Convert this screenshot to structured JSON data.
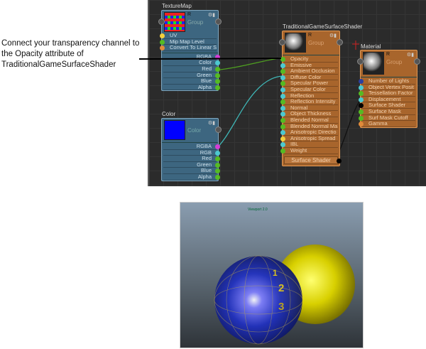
{
  "callout": {
    "text": "Connect your transparency channel to the Opacity attribute of TraditionalGameSurfaceShader"
  },
  "nodes": {
    "texturemap": {
      "title": "TextureMap",
      "header_r": "R",
      "header_group": "Group",
      "inputs": [
        {
          "label": "UV",
          "color": "#f2cf3c"
        },
        {
          "label": "Mip Map Level",
          "color": "#55bb22"
        },
        {
          "label": "Convert To Linear S",
          "color": "#e08a3a"
        }
      ],
      "outputs": [
        {
          "label": "RGBA",
          "color": "#d63cd6"
        },
        {
          "label": "Color",
          "color": "#4cc9d0"
        },
        {
          "label": "Red",
          "color": "#55bb22"
        },
        {
          "label": "Green",
          "color": "#55bb22"
        },
        {
          "label": "Blue",
          "color": "#55bb22"
        },
        {
          "label": "Alpha",
          "color": "#55bb22"
        }
      ]
    },
    "color": {
      "title": "Color",
      "header_label": "Color",
      "swatch": "#0000ff",
      "outputs": [
        {
          "label": "RGBA",
          "color": "#d63cd6"
        },
        {
          "label": "RGB",
          "color": "#4cc9d0"
        },
        {
          "label": "Red",
          "color": "#55bb22"
        },
        {
          "label": "Green",
          "color": "#55bb22"
        },
        {
          "label": "Blue",
          "color": "#55bb22"
        },
        {
          "label": "Alpha",
          "color": "#55bb22"
        }
      ]
    },
    "shader": {
      "title": "TraditionalGameSurfaceShader",
      "header_r": "R",
      "header_group": "Group",
      "footer": "Surface Shader",
      "inputs": [
        {
          "label": "Opacity",
          "color": "#55bb22"
        },
        {
          "label": "Emissive",
          "color": "#4cc9d0"
        },
        {
          "label": "Ambient Occlusion",
          "color": "#55bb22"
        },
        {
          "label": "Diffuse Color",
          "color": "#4cc9d0"
        },
        {
          "label": "Specular Power",
          "color": "#55bb22"
        },
        {
          "label": "Specular Color",
          "color": "#4cc9d0"
        },
        {
          "label": "Reflection",
          "color": "#4cc9d0"
        },
        {
          "label": "Reflection Intensity",
          "color": "#55bb22"
        },
        {
          "label": "Normal",
          "color": "#4cc9d0"
        },
        {
          "label": "Object Thickness",
          "color": "#4cc9d0"
        },
        {
          "label": "Blended Normal",
          "color": "#55bb22"
        },
        {
          "label": "Blended Normal Ma",
          "color": "#55bb22"
        },
        {
          "label": "Anisotropic Directio",
          "color": "#4cc9d0"
        },
        {
          "label": "Anisotropic Spread",
          "color": "#f2cf3c"
        },
        {
          "label": "IBL",
          "color": "#4cc9d0"
        },
        {
          "label": "Weight",
          "color": "#55bb22"
        }
      ]
    },
    "material": {
      "title": "Material",
      "header_r": "R",
      "header_group": "Group",
      "inputs": [
        {
          "label": "Number of Lights",
          "color": "#2a3fa0"
        },
        {
          "label": "Object Vertex Posit",
          "color": "#4cc9d0"
        },
        {
          "label": "Tessellation Factor",
          "color": "#55bb22"
        },
        {
          "label": "Displacement",
          "color": "#4cc9d0"
        },
        {
          "label": "Surface Shader",
          "color": "#000000"
        },
        {
          "label": "Surface Mask",
          "color": "#55bb22"
        },
        {
          "label": "Surf Mask Cutoff",
          "color": "#55bb22"
        },
        {
          "label": "Gamma",
          "color": "#e08a3a"
        }
      ]
    }
  },
  "viewport": {
    "title": "Viewport 2.0",
    "sphere_numbers": [
      "1",
      "2",
      "3"
    ]
  }
}
